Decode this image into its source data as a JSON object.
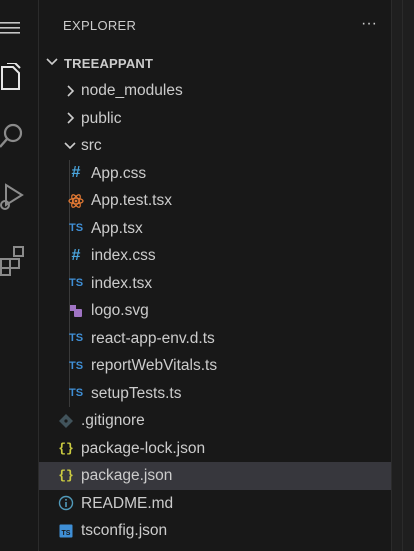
{
  "explorer": {
    "title": "EXPLORER",
    "more_label": "···",
    "section_title": "TREEAPPANT"
  },
  "tree": [
    {
      "label": "node_modules",
      "kind": "folder-collapsed",
      "icon": "chevron-right-icon"
    },
    {
      "label": "public",
      "kind": "folder-collapsed",
      "icon": "chevron-right-icon"
    },
    {
      "label": "src",
      "kind": "folder-expanded",
      "icon": "chevron-down-icon"
    },
    {
      "label": "App.css",
      "kind": "file",
      "icon": "css-hash-icon",
      "glyph": "#"
    },
    {
      "label": "App.test.tsx",
      "kind": "file",
      "icon": "react-atom-icon"
    },
    {
      "label": "App.tsx",
      "kind": "file",
      "icon": "typescript-icon",
      "glyph": "TS"
    },
    {
      "label": "index.css",
      "kind": "file",
      "icon": "css-hash-icon",
      "glyph": "#"
    },
    {
      "label": "index.tsx",
      "kind": "file",
      "icon": "typescript-icon",
      "glyph": "TS"
    },
    {
      "label": "logo.svg",
      "kind": "file",
      "icon": "svg-file-icon"
    },
    {
      "label": "react-app-env.d.ts",
      "kind": "file",
      "icon": "typescript-icon",
      "glyph": "TS"
    },
    {
      "label": "reportWebVitals.ts",
      "kind": "file",
      "icon": "typescript-icon",
      "glyph": "TS"
    },
    {
      "label": "setupTests.ts",
      "kind": "file",
      "icon": "typescript-icon",
      "glyph": "TS"
    },
    {
      "label": ".gitignore",
      "kind": "file",
      "icon": "git-diamond-icon"
    },
    {
      "label": "package-lock.json",
      "kind": "file",
      "icon": "json-braces-icon",
      "glyph": "{}"
    },
    {
      "label": "package.json",
      "kind": "file",
      "icon": "json-braces-icon",
      "glyph": "{}",
      "selected": true
    },
    {
      "label": "README.md",
      "kind": "file",
      "icon": "info-circle-icon"
    },
    {
      "label": "tsconfig.json",
      "kind": "file",
      "icon": "tsconfig-icon",
      "glyph": "TS"
    }
  ]
}
